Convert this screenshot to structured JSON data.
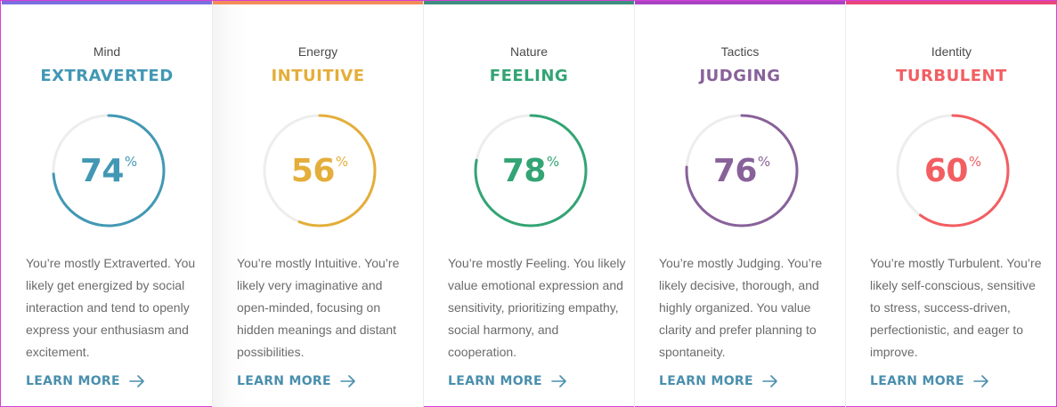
{
  "cards": [
    {
      "category": "Mind",
      "trait": "EXTRAVERTED",
      "percent": 74,
      "percent_sign": "%",
      "description": "You’re mostly Extraverted. You likely get energized by social interaction and tend to openly express your enthusiasm and excitement.",
      "link_label": "LEARN MORE",
      "color": "#4298b4",
      "bar_color": "#7b6fe0"
    },
    {
      "category": "Energy",
      "trait": "INTUITIVE",
      "percent": 56,
      "percent_sign": "%",
      "description": "You’re mostly Intuitive. You’re likely very imaginative and open-minded, focusing on hidden meanings and distant possibilities.",
      "link_label": "LEARN MORE",
      "color": "#e4ae3a",
      "bar_color": "#f28c5a"
    },
    {
      "category": "Nature",
      "trait": "FEELING",
      "percent": 78,
      "percent_sign": "%",
      "description": "You’re mostly Feeling. You likely value emotional expression and sensitivity, prioritizing empathy, social harmony, and cooperation.",
      "link_label": "LEARN MORE",
      "color": "#33a474",
      "bar_color": "#3f8f7f"
    },
    {
      "category": "Tactics",
      "trait": "JUDGING",
      "percent": 76,
      "percent_sign": "%",
      "description": "You’re mostly Judging. You’re likely decisive, thorough, and highly organized. You value clarity and prefer planning to spontaneity.",
      "link_label": "LEARN MORE",
      "color": "#88619a",
      "bar_color": "#a844c4"
    },
    {
      "category": "Identity",
      "trait": "TURBULENT",
      "percent": 60,
      "percent_sign": "%",
      "description": "You’re mostly Turbulent. You’re likely self-conscious, sensitive to stress, success-driven, perfectionistic, and eager to improve.",
      "link_label": "LEARN MORE",
      "color": "#f25e62",
      "bar_color": "#e8467a"
    }
  ],
  "ring_track_color": "#ededed",
  "link_color": "#4a8fad",
  "icons": {
    "link_arrow": "arrow-right-icon"
  }
}
